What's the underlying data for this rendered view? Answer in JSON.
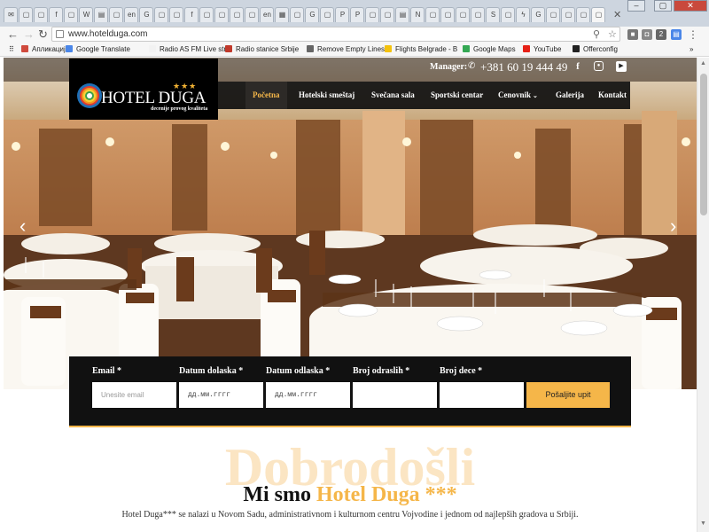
{
  "browser": {
    "url": "www.hoteldugа.com",
    "tab_icons": [
      "mail-icon",
      "doc-icon",
      "doc-icon",
      "facebook-icon",
      "doc-icon",
      "wikipedia-icon",
      "news-icon",
      "doc-icon",
      "en-icon",
      "google-icon",
      "doc-icon",
      "doc-icon",
      "facebook-icon",
      "doc-icon",
      "doc-icon",
      "doc-icon",
      "doc-icon",
      "en-icon",
      "chart-icon",
      "doc-icon",
      "google-icon",
      "doc-icon",
      "p-icon",
      "p-icon",
      "doc-icon",
      "doc-icon",
      "news-icon",
      "n-icon",
      "doc-icon",
      "doc-icon",
      "doc-icon",
      "doc-icon",
      "s-icon",
      "doc-icon",
      "bolt-icon",
      "google-icon",
      "doc-icon",
      "doc-icon",
      "doc-icon",
      "doc-icon"
    ],
    "bookmarks": [
      {
        "label": "Апликације",
        "color": "#d04a3d"
      },
      {
        "label": "Google Translate",
        "color": "#4a86e8"
      },
      {
        "label": "Radio AS FM Live str",
        "color": "#f2f2f2"
      },
      {
        "label": "Radio stanice Srbije",
        "color": "#c0392b"
      },
      {
        "label": "Remove Empty Lines",
        "color": "#666666"
      },
      {
        "label": "Flights Belgrade - B",
        "color": "#f4c20d"
      },
      {
        "label": "Google Maps",
        "color": "#34a853"
      },
      {
        "label": "YouTube",
        "color": "#e62117"
      },
      {
        "label": "Offerconfig",
        "color": "#222222"
      }
    ],
    "more_label": "»"
  },
  "header": {
    "manager_label": "Manager:",
    "phone": "+381 60 19 444 49",
    "social": [
      "facebook-icon",
      "instagram-icon",
      "youtube-icon"
    ]
  },
  "logo": {
    "name": "HOTEL DUGA",
    "stars": "★★★",
    "tagline": "decenije provog kvaliteta"
  },
  "nav": {
    "items": [
      "Početna",
      "Hotelski smeštaj",
      "Svečana sala",
      "Sportski centar",
      "Cenovnik",
      "Galerija",
      "Kontakt"
    ],
    "active": "Početna",
    "dropdown_chevron": "⌄"
  },
  "booking": {
    "email_label": "Email *",
    "email_placeholder": "Unesite email",
    "arrival_label": "Datum dolaska *",
    "departure_label": "Datum odlaska *",
    "adults_label": "Broj odraslih *",
    "kids_label": "Broj dece *",
    "date_placeholder": "дд.мм.гггг",
    "submit": "Pošaljite upit"
  },
  "welcome": {
    "bg_word": "Dobrodošli",
    "title_prefix": "Mi smo",
    "title_highlight": "Hotel Duga ***",
    "text": "Hotel Duga*** se nalazi u Novom Sadu, administrativnom i kulturnom centru Vojvodine i jednom od najlepših gradova u Srbiji.",
    "text2": "...................................................................................................................."
  },
  "colors": {
    "accent": "#f5b649",
    "navbar": "#0f0f0f",
    "booking_bg": "#111111"
  }
}
